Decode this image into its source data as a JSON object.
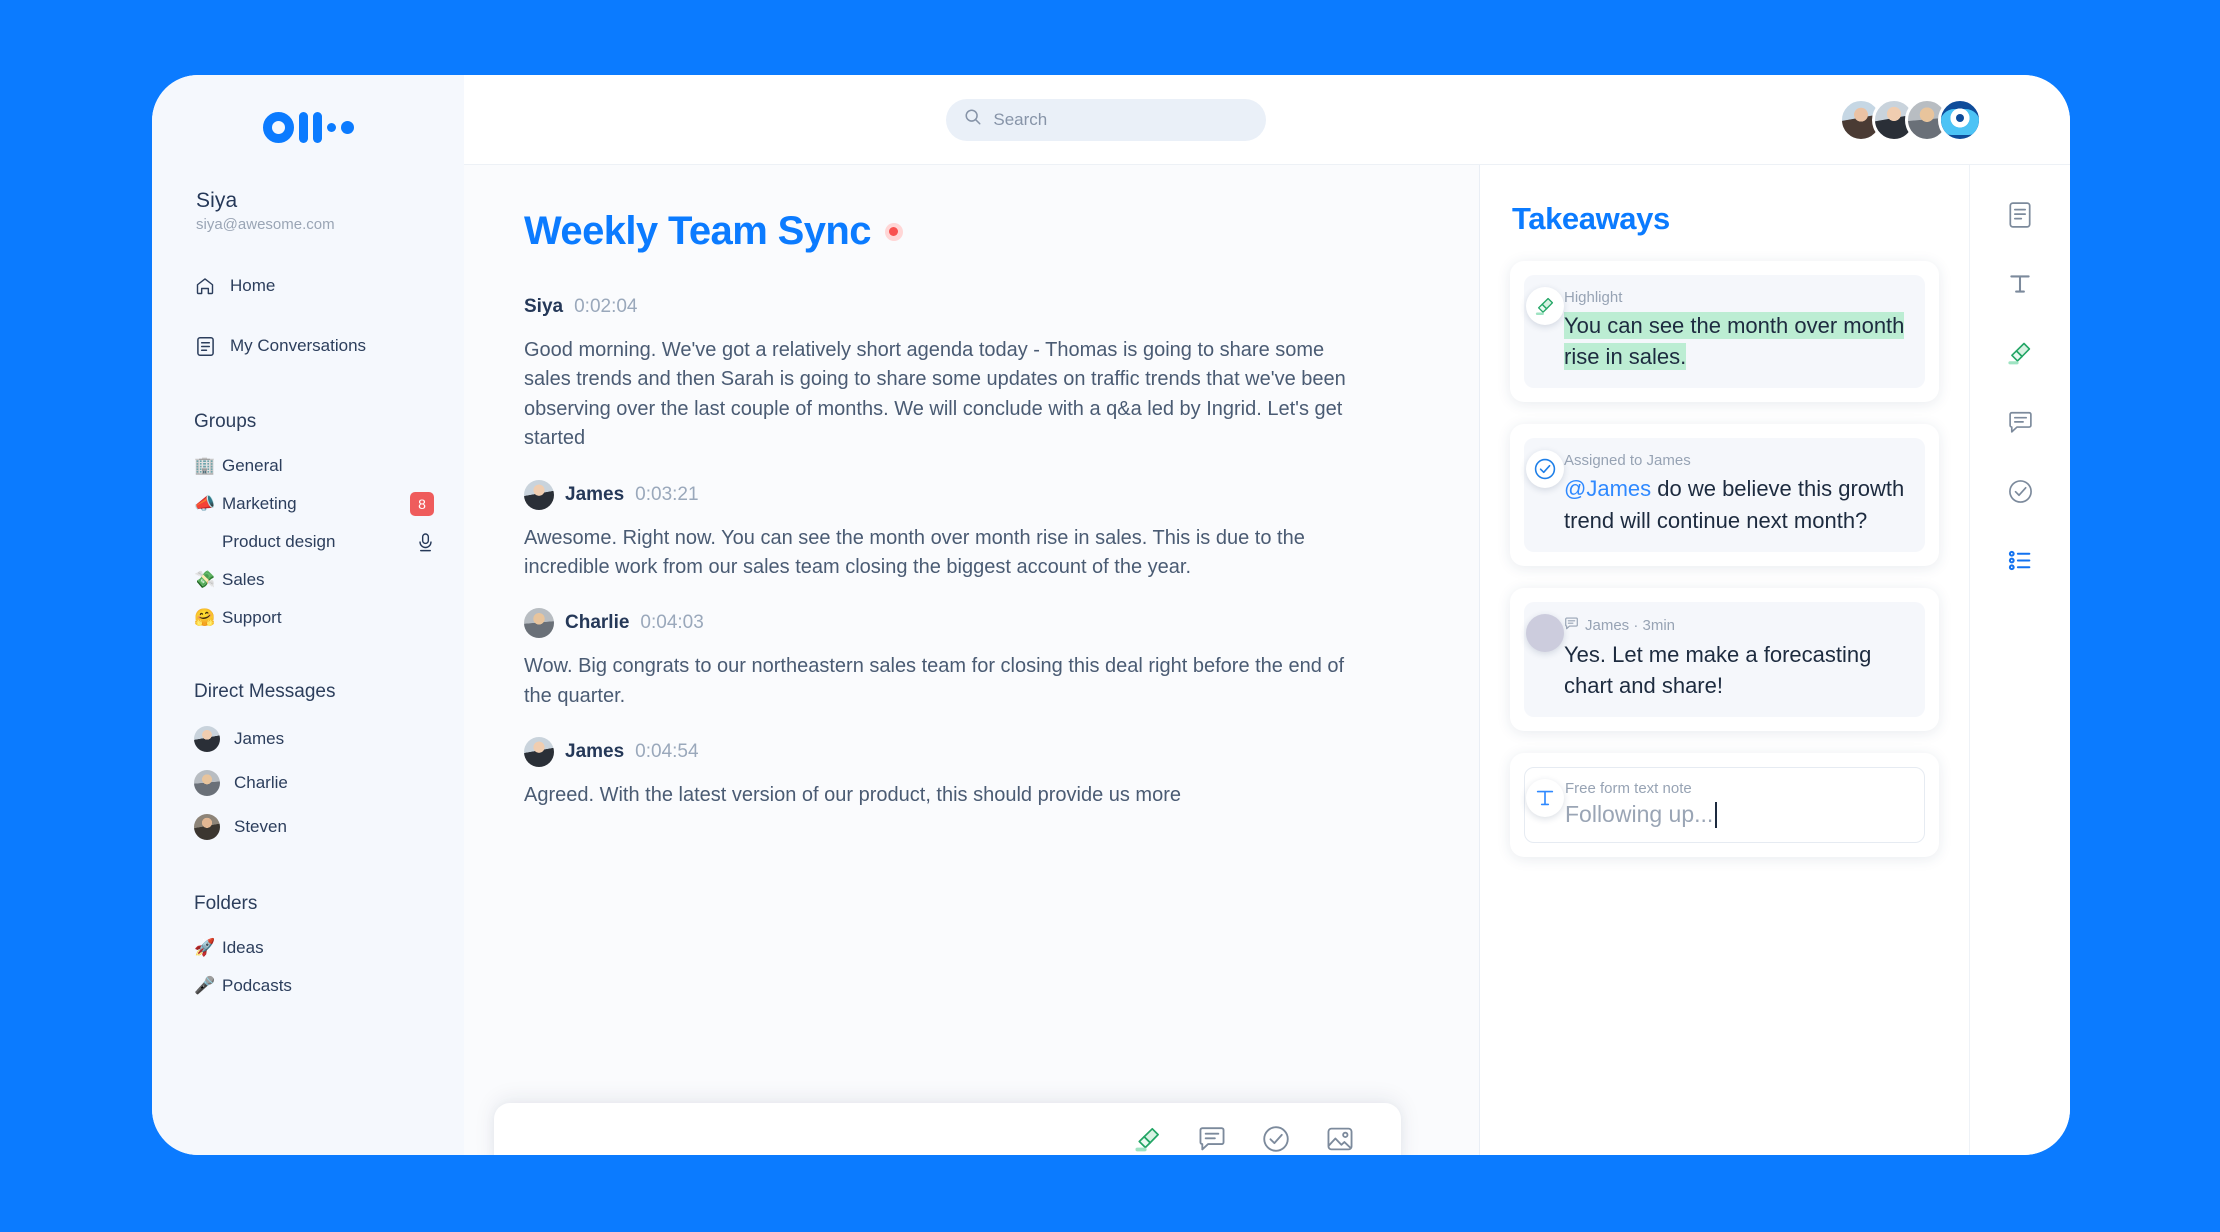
{
  "brand": {
    "logo_name": "otter-logo",
    "accent": "#0b7bff",
    "highlight_green": "#bcedd3",
    "badge_red": "#ef5c5c"
  },
  "sidebar": {
    "user": {
      "name": "Siya",
      "email": "siya@awesome.com"
    },
    "nav": [
      {
        "label": "Home",
        "icon": "home-icon"
      },
      {
        "label": "My Conversations",
        "icon": "conversations-icon"
      }
    ],
    "groups": {
      "title": "Groups",
      "items": [
        {
          "label": "General",
          "emoji": "🏢",
          "badge": "",
          "mic": false
        },
        {
          "label": "Marketing",
          "emoji": "📣",
          "badge": "8",
          "mic": false
        },
        {
          "label": "Product design",
          "emoji": "",
          "badge": "",
          "mic": true,
          "sub": true
        },
        {
          "label": "Sales",
          "emoji": "💸",
          "badge": "",
          "mic": false
        },
        {
          "label": "Support",
          "emoji": "🤗",
          "badge": "",
          "mic": false
        }
      ]
    },
    "direct_messages": {
      "title": "Direct Messages",
      "items": [
        {
          "label": "James",
          "avatar": "av-james"
        },
        {
          "label": "Charlie",
          "avatar": "av-charlie"
        },
        {
          "label": "Steven",
          "avatar": "av-steven"
        }
      ]
    },
    "folders": {
      "title": "Folders",
      "items": [
        {
          "label": "Ideas",
          "emoji": "🚀"
        },
        {
          "label": "Podcasts",
          "emoji": "🎤"
        }
      ]
    }
  },
  "topbar": {
    "search_placeholder": "Search",
    "avatars": [
      "siya",
      "james",
      "charlie",
      "otter-app"
    ]
  },
  "document": {
    "title": "Weekly Team Sync",
    "recording": true,
    "messages": [
      {
        "speaker": "Siya",
        "timestamp": "0:02:04",
        "avatar": "",
        "text": "Good morning. We've got a relatively short agenda today - Thomas is going to share some sales trends and then Sarah is going to share some updates on traffic trends that we've been observing over the last couple of months. We will conclude with a q&a led by Ingrid. Let's get started"
      },
      {
        "speaker": "James",
        "timestamp": "0:03:21",
        "avatar": "av-james",
        "text": "Awesome. Right now. You can see the month over month rise in sales. This is due to the incredible work from our sales team closing the biggest account of the year."
      },
      {
        "speaker": "Charlie",
        "timestamp": "0:04:03",
        "avatar": "av-charlie",
        "text": "Wow. Big congrats to our northeastern sales team for closing this deal right before the end of the quarter."
      },
      {
        "speaker": "James",
        "timestamp": "0:04:54",
        "avatar": "av-james",
        "text": "Agreed. With the latest version of our product, this should provide us more"
      }
    ]
  },
  "float_toolbar": [
    {
      "icon": "highlighter-icon"
    },
    {
      "icon": "comment-icon"
    },
    {
      "icon": "check-circle-icon"
    },
    {
      "icon": "image-icon"
    }
  ],
  "takeaways": {
    "title": "Takeaways",
    "cards": [
      {
        "type": "highlight",
        "icon": "highlighter-icon",
        "meta": "Highlight",
        "text": "You can see the month over month rise in sales.",
        "highlighted": true
      },
      {
        "type": "action",
        "icon": "check-circle-icon",
        "meta": "Assigned to James",
        "mention": "@James",
        "text": " do we believe this growth trend will continue next month?"
      },
      {
        "type": "comment",
        "icon": "avatar-james",
        "meta": "James · 3min",
        "meta_icon": "comment-icon",
        "text": "Yes. Let me make a forecasting chart and share!"
      },
      {
        "type": "note",
        "icon": "text-icon",
        "meta": "Free form text note",
        "value": "Following up..."
      }
    ]
  },
  "rail": [
    {
      "icon": "notes-icon",
      "active": false
    },
    {
      "icon": "text-icon",
      "active": false
    },
    {
      "icon": "highlighter-icon",
      "active": false
    },
    {
      "icon": "comment-icon",
      "active": false
    },
    {
      "icon": "check-circle-icon",
      "active": false
    },
    {
      "icon": "list-icon",
      "active": true
    }
  ]
}
